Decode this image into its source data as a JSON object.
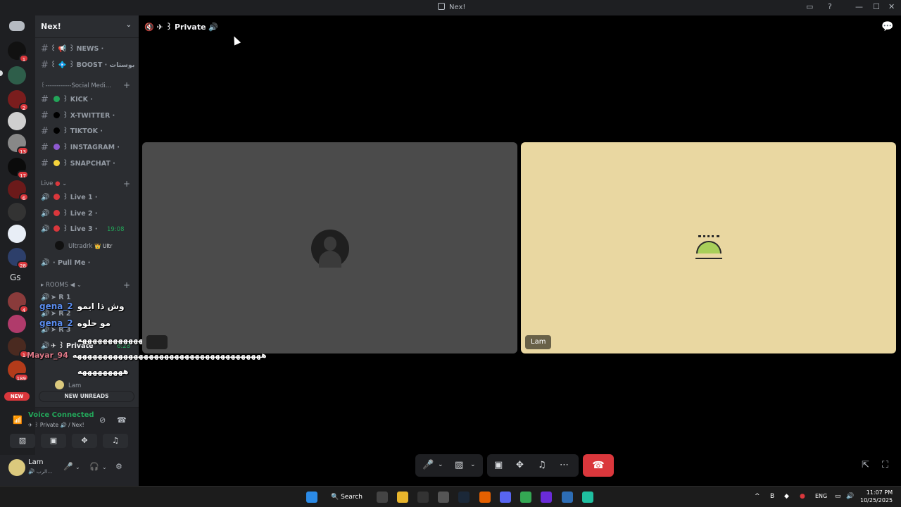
{
  "window": {
    "title": "Nex!"
  },
  "rail": {
    "badges": [
      "1",
      "2",
      "13",
      "17",
      "6",
      "28",
      "4",
      "1",
      "189"
    ],
    "gs_label": "Gs",
    "new_label": "NEW"
  },
  "guild": {
    "name": "Nex!"
  },
  "channels": [
    {
      "label": "꒰ 📢 ꒱ NEWS ·",
      "type": "text"
    },
    {
      "label": "꒰ 💠 ꒱ BOOST · بوستات",
      "type": "text"
    },
    {
      "label": "꒰------------Social Medi...",
      "type": "category"
    },
    {
      "label": "꒱ KICK ·",
      "type": "text",
      "dot": "#23a559"
    },
    {
      "label": "꒱ X-TWITTER ·",
      "type": "text",
      "dot": "#000000"
    },
    {
      "label": "꒱ TIKTOK ·",
      "type": "text",
      "dot": "#000000"
    },
    {
      "label": "꒱ INSTAGRAM ·",
      "type": "text",
      "dot": "#8e5ad1"
    },
    {
      "label": "꒱ SNAPCHAT ·",
      "type": "text",
      "dot": "#f5d33b"
    }
  ],
  "live_category": "Live",
  "voice_channels": [
    {
      "label": "꒱ Live 1 ·",
      "dot": "#da373c"
    },
    {
      "label": "꒱ Live 2 ·",
      "dot": "#da373c"
    },
    {
      "label": "꒱ Live 3 ·",
      "dot": "#da373c",
      "time": "19:08"
    }
  ],
  "live3_member": {
    "name": "Ultradrk",
    "tag": "👑 Ultr"
  },
  "pull_me": "· Pull Me ·",
  "rooms_category": "ROOMS ◀",
  "rooms": [
    "➤ R 1",
    "➤ R 2",
    "➤ R 3"
  ],
  "private_channel": {
    "label": "✈ ꒱ Private",
    "time": "6:28"
  },
  "private_members": [
    "Lam"
  ],
  "new_unreads": "NEW UNREADS",
  "chat_overlay": [
    {
      "user": "gena_2",
      "message": "وش ذا ايمو"
    },
    {
      "user": "gena_2",
      "message": "مو حلوه"
    },
    {
      "user": "",
      "message": "ههههههههههههههههههههههههههه"
    },
    {
      "user": "Mayar_94",
      "message": "هههههههههههههههههههههههههههههههههههههه"
    },
    {
      "user": "",
      "message": "هههههههههه"
    }
  ],
  "voice": {
    "status": "Voice Connected",
    "channel": "✈ ꒱ Private 🔊 / Nex!"
  },
  "user": {
    "name": "Lam",
    "status": "🔊 الرب..."
  },
  "stage": {
    "header": "🔇 ✈ ꒱ Private 🔊",
    "tiles": [
      {
        "name": ""
      },
      {
        "name": "Lam"
      }
    ]
  },
  "taskbar": {
    "search": "Search",
    "lang": "ENG",
    "time": "11:07 PM",
    "date": "10/25/2025"
  },
  "colors": {
    "accent_green": "#23a559",
    "danger": "#da373c",
    "tile_lam": "#e9d7a1"
  }
}
